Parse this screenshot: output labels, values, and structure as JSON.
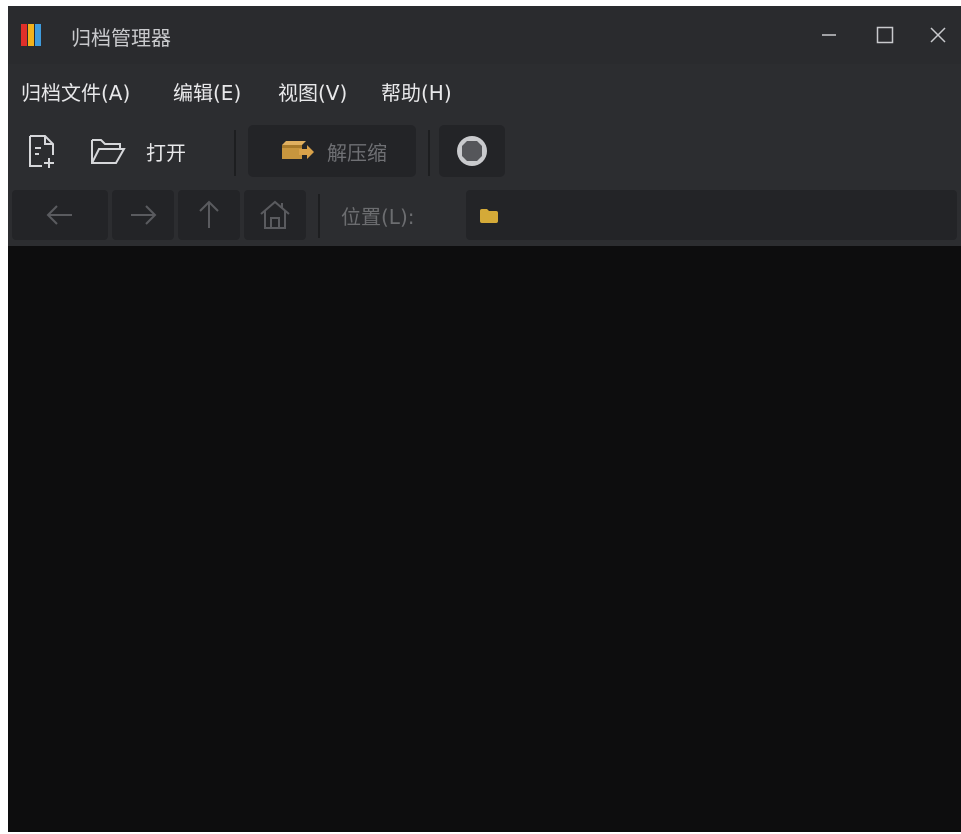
{
  "window": {
    "title": "归档管理器",
    "icon": "archive-manager-icon",
    "controls": [
      "minimize-icon",
      "maximize-icon",
      "close-icon"
    ],
    "app_icon_colors": [
      "#e0302a",
      "#f2b21b",
      "#3f9bdc"
    ]
  },
  "menubar": {
    "items": [
      {
        "label": "归档文件(A)"
      },
      {
        "label": "编辑(E)"
      },
      {
        "label": "视图(V)"
      },
      {
        "label": "帮助(H)"
      }
    ]
  },
  "toolbar": {
    "new_icon": "new-archive-icon",
    "open_icon": "folder-open-icon",
    "open_label": "打开",
    "extract_icon": "extract-box-icon",
    "extract_label": "解压缩",
    "stop_icon": "stop-icon"
  },
  "navbar": {
    "back_icon": "arrow-left-icon",
    "forward_icon": "arrow-right-icon",
    "up_icon": "arrow-up-icon",
    "home_icon": "home-icon",
    "location_label": "位置(L):",
    "location_value": "",
    "folder_icon": "folder-icon"
  },
  "colors": {
    "titlebar_bg": "#2a2b2e",
    "bar_bg": "#2c2d30",
    "button_bg": "#232427",
    "content_bg": "#0d0d0e",
    "folder_color": "#d4aa38",
    "extract_icon_color": "#c8963e"
  }
}
